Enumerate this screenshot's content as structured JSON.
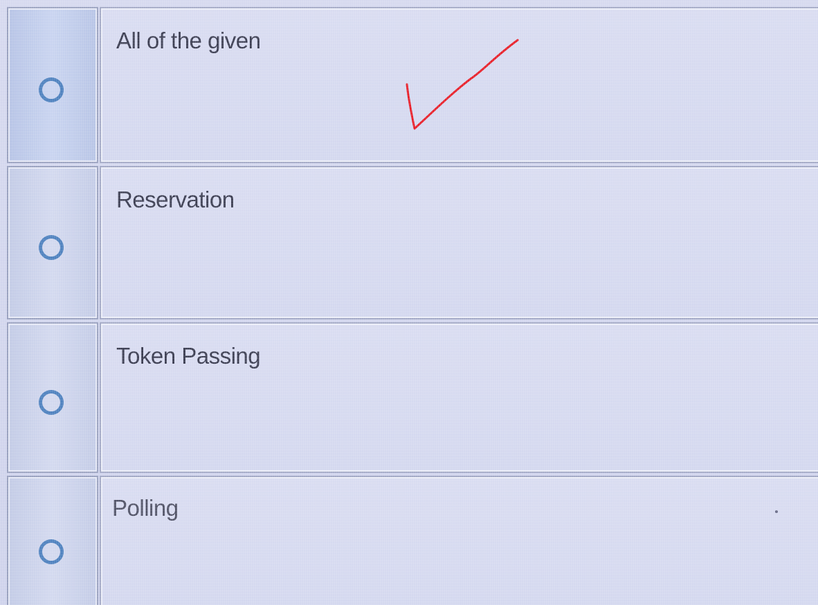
{
  "question": {
    "options": [
      {
        "label": "All of the given",
        "selected": false
      },
      {
        "label": "Reservation",
        "selected": false
      },
      {
        "label": "Token Passing",
        "selected": false
      },
      {
        "label": "Polling",
        "selected": false
      }
    ]
  },
  "annotation": {
    "type": "handwritten-checkmark",
    "marks_option": "All of the given",
    "color": "#e8202a"
  },
  "colors": {
    "radio_ring": "#4f82bf",
    "text": "#3c3e52"
  }
}
